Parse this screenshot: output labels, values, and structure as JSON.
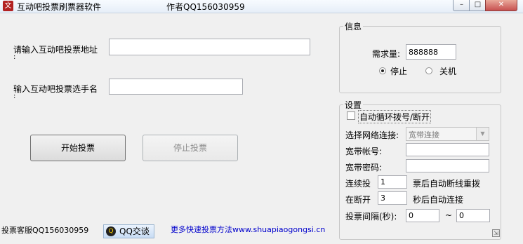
{
  "window": {
    "title": "互动吧投票刷票器软件",
    "author": "作者QQ156030959",
    "min_glyph": "–",
    "max_glyph": "□",
    "close_glyph": "✕"
  },
  "form": {
    "url_label": "请输入互动吧投票地址",
    "url_colon": ":",
    "url_value": "",
    "name_label": "输入互动吧投票选手名",
    "name_colon": ":",
    "name_value": "",
    "start_button": "开始投票",
    "stop_button": "停止投票"
  },
  "info": {
    "group_title": "信息",
    "demand_label": "需求量:",
    "demand_value": "888888",
    "option_stop": "停止",
    "option_shutdown": "关机",
    "selected": "停止"
  },
  "settings": {
    "group_title": "设置",
    "auto_dial_label": "自动循环拨号/断开",
    "auto_dial_checked": false,
    "network_label": "选择网络连接:",
    "network_value": "宽带连接",
    "account_label": "宽带帐号:",
    "account_value": "",
    "password_label": "宽带密码:",
    "password_value": "",
    "continuous_label": "连续投",
    "continuous_value": "1",
    "continuous_suffix": "票后自动断线重拨",
    "reconnect_label": "在断开",
    "reconnect_value": "3",
    "reconnect_suffix": "秒后自动连接",
    "interval_label": "投票间隔(秒):",
    "interval_from": "0",
    "interval_sep": "~",
    "interval_to": "0"
  },
  "footer": {
    "support_text": "投票客服QQ156030959",
    "qq_button": "QQ交谈",
    "qq_icon_glyph": "Q",
    "link_text": "更多快速投票方法www.shuapiaogongsi.cn",
    "grip_glyph": "⇲"
  },
  "icons": {
    "app_glyph": "文"
  }
}
